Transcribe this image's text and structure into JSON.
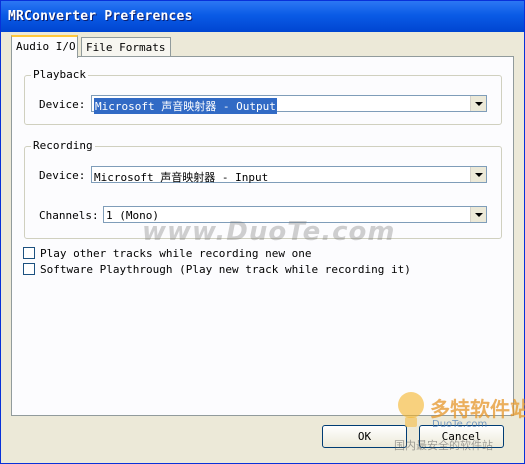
{
  "window": {
    "title": "MRConverter Preferences"
  },
  "tabs": [
    {
      "label": "Audio I/O",
      "active": true
    },
    {
      "label": "File Formats",
      "active": false
    }
  ],
  "playback": {
    "group_label": "Playback",
    "device_label": "Device:",
    "device_value": "Microsoft 声音映射器 - Output"
  },
  "recording": {
    "group_label": "Recording",
    "device_label": "Device:",
    "device_value": "Microsoft 声音映射器 - Input",
    "channels_label": "Channels:",
    "channels_value": "1 (Mono)"
  },
  "options": {
    "play_other_tracks": {
      "label": "Play other tracks while recording new one",
      "checked": false
    },
    "software_playthrough": {
      "label": "Software Playthrough (Play new track while recording it)",
      "checked": false
    }
  },
  "buttons": {
    "ok": "OK",
    "cancel": "Cancel"
  },
  "watermark": {
    "text": "www.DuoTe.com",
    "logo_main": "多特软件站",
    "logo_sub": "DuoTe.com",
    "logo_cn": "国内最安全的软件站"
  },
  "colors": {
    "titlebar": "#0a5be6",
    "window_bg": "#ece9d8",
    "selection": "#316ac5",
    "tab_highlight": "#ffc83c"
  }
}
